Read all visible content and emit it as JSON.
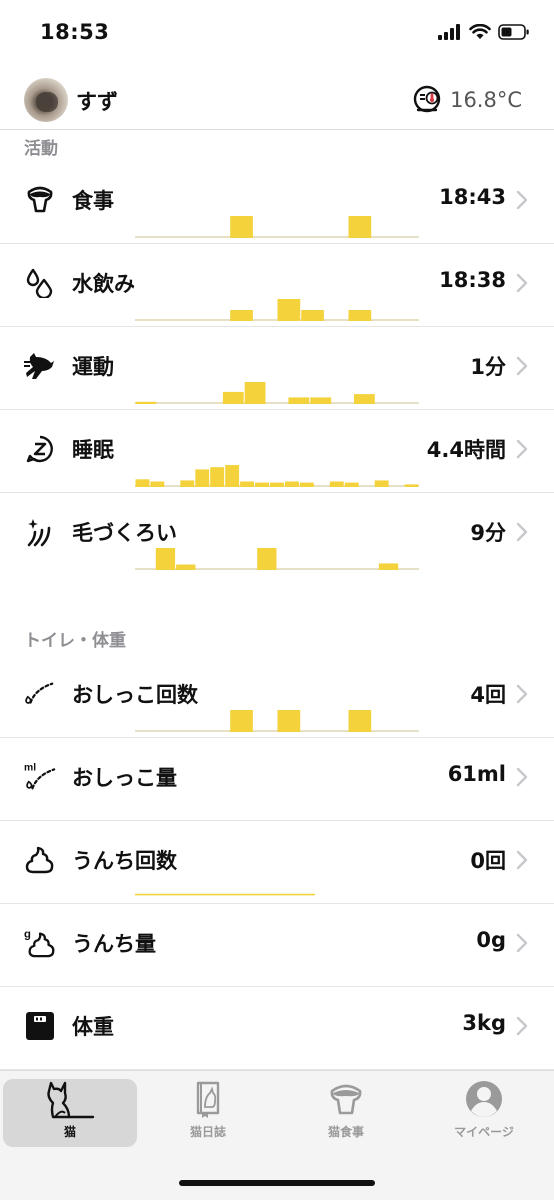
{
  "status_bar": {
    "time": "18:53"
  },
  "header": {
    "cat_name": "すず",
    "temperature": "16.8°C"
  },
  "sections": {
    "activity": {
      "title": "活動",
      "rows": [
        {
          "label": "食事",
          "value": "18:43",
          "icon": "food-bowl-icon"
        },
        {
          "label": "水飲み",
          "value": "18:38",
          "icon": "water-drops-icon"
        },
        {
          "label": "運動",
          "value": "1分",
          "icon": "running-cat-icon"
        },
        {
          "label": "睡眠",
          "value": "4.4時間",
          "icon": "sleep-icon"
        },
        {
          "label": "毛づくろい",
          "value": "9分",
          "icon": "grooming-icon"
        }
      ]
    },
    "toilet": {
      "title": "トイレ・体重",
      "rows": [
        {
          "label": "おしっこ回数",
          "value": "4回",
          "icon": "urine-count-icon"
        },
        {
          "label": "おしっこ量",
          "value": "61ml",
          "icon": "urine-volume-icon",
          "icon_text": "ml"
        },
        {
          "label": "うんち回数",
          "value": "0回",
          "icon": "poop-count-icon"
        },
        {
          "label": "うんち量",
          "value": "0g",
          "icon": "poop-weight-icon",
          "icon_text": "g"
        },
        {
          "label": "体重",
          "value": "3kg",
          "icon": "weight-scale-icon"
        }
      ]
    }
  },
  "sparklines": {
    "meal": [
      0,
      0,
      0,
      0,
      1,
      0,
      0,
      0,
      0,
      1,
      0,
      0
    ],
    "water": [
      0,
      0,
      0,
      0,
      0.5,
      0,
      1,
      0.5,
      0,
      0.5,
      0,
      0
    ],
    "exercise": [
      0.1,
      0,
      0,
      0,
      0.55,
      1,
      0,
      0.3,
      0.3,
      0,
      0.45,
      0,
      0
    ],
    "sleep": [
      0.35,
      0.25,
      0,
      0.3,
      0.8,
      0.9,
      1,
      0.25,
      0.2,
      0.2,
      0.25,
      0.2,
      0,
      0.25,
      0.2,
      0,
      0.3,
      0,
      0.12
    ],
    "grooming": [
      0,
      1,
      0.25,
      0,
      0,
      0,
      1,
      0,
      0,
      0,
      0,
      0,
      0.3,
      0
    ],
    "urine_count": [
      0,
      0,
      0,
      0,
      1,
      0,
      1,
      0,
      0,
      1,
      0,
      0
    ],
    "urine_volume": [],
    "poop_count": [],
    "poop_weight": [],
    "weight": []
  },
  "accent_color": "#f4d23c",
  "tabs": [
    {
      "label": "猫",
      "icon": "cat-icon",
      "active": true
    },
    {
      "label": "猫日誌",
      "icon": "diary-icon",
      "active": false
    },
    {
      "label": "猫食事",
      "icon": "food-bowl-icon",
      "active": false
    },
    {
      "label": "マイページ",
      "icon": "person-icon",
      "active": false
    }
  ]
}
